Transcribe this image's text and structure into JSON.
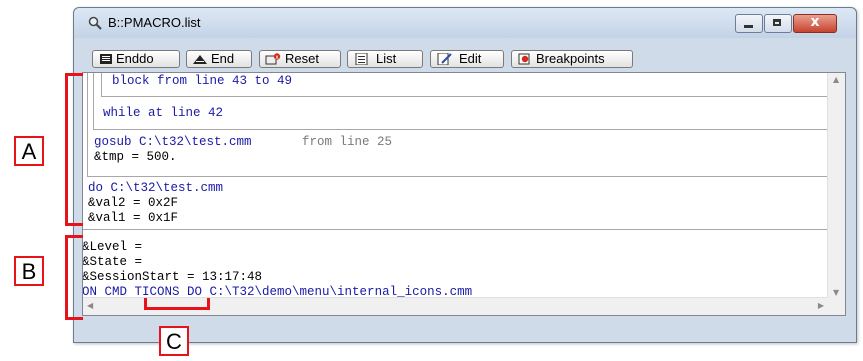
{
  "window": {
    "title": "B::PMACRO.list",
    "min_label": "",
    "max_label": "",
    "close_label": "x"
  },
  "toolbar": {
    "buttons": [
      {
        "label": "Enddo",
        "icon": "enddo-icon"
      },
      {
        "label": "End",
        "icon": "end-icon"
      },
      {
        "label": "Reset",
        "icon": "reset-icon"
      },
      {
        "label": "List",
        "icon": "list-icon"
      },
      {
        "label": "Edit",
        "icon": "edit-icon"
      },
      {
        "label": "Breakpoints",
        "icon": "breakpoints-icon"
      }
    ]
  },
  "stack": {
    "block_line": "block from line 43 to 49",
    "while_line": "while at line 42",
    "gosub_cmd": "gosub C:\\t32\\test.cmm",
    "gosub_from": "from line 25",
    "gosub_var": "&tmp = 500.",
    "do_cmd": "do C:\\t32\\test.cmm",
    "do_var1": "&val2 = 0x2F",
    "do_var2": "&val1 = 0x1F"
  },
  "globals": {
    "line1": "&Level =",
    "line2": "&State =",
    "line3": "&SessionStart = 13:17:48",
    "on_cmd_prefix": "ON CMD ",
    "on_cmd_name": "TICONS",
    "on_cmd_suffix": " DO C:\\T32\\demo\\menu\\internal_icons.cmm"
  },
  "annotations": {
    "a": "A",
    "b": "B",
    "c": "C",
    "color": "#e8121a"
  },
  "colors": {
    "code_blue": "#1a1aa8",
    "text_gray": "#7a7a7a",
    "window_frame": "#cfdbe9"
  }
}
